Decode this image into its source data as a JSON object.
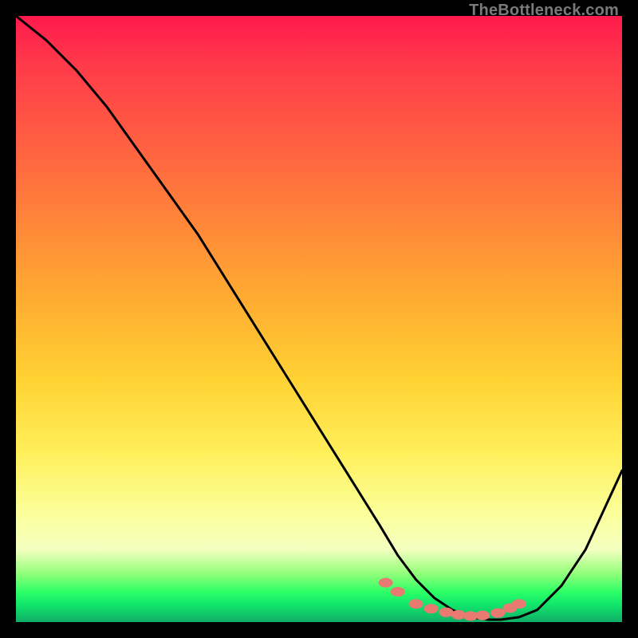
{
  "watermark": "TheBottleneck.com",
  "chart_data": {
    "type": "line",
    "title": "",
    "xlabel": "",
    "ylabel": "",
    "xlim": [
      0,
      100
    ],
    "ylim": [
      0,
      100
    ],
    "series": [
      {
        "name": "bottleneck-curve",
        "x": [
          0,
          5,
          10,
          15,
          20,
          25,
          30,
          35,
          40,
          45,
          50,
          55,
          60,
          63,
          66,
          69,
          72,
          75,
          78,
          80,
          83,
          86,
          90,
          94,
          100
        ],
        "y": [
          100,
          96,
          91,
          85,
          78,
          71,
          64,
          56,
          48,
          40,
          32,
          24,
          16,
          11,
          7,
          4,
          2,
          0.8,
          0.4,
          0.4,
          0.8,
          2,
          6,
          12,
          25
        ]
      }
    ],
    "markers": {
      "name": "optimal-range-markers",
      "color": "#e87a72",
      "xy": [
        [
          61,
          6.5
        ],
        [
          63,
          5.0
        ],
        [
          66,
          3.0
        ],
        [
          68.5,
          2.2
        ],
        [
          71,
          1.6
        ],
        [
          73,
          1.2
        ],
        [
          75,
          1.0
        ],
        [
          77,
          1.1
        ],
        [
          79.5,
          1.5
        ],
        [
          81.5,
          2.3
        ],
        [
          83,
          3.0
        ]
      ]
    },
    "gradient_stops": [
      {
        "pos": 0,
        "color": "#ff1a4d"
      },
      {
        "pos": 8,
        "color": "#ff3a4a"
      },
      {
        "pos": 25,
        "color": "#ff6b3f"
      },
      {
        "pos": 45,
        "color": "#ffa732"
      },
      {
        "pos": 60,
        "color": "#ffd233"
      },
      {
        "pos": 72,
        "color": "#ffef5a"
      },
      {
        "pos": 82,
        "color": "#fbff9a"
      },
      {
        "pos": 88,
        "color": "#f4ffc0"
      },
      {
        "pos": 92,
        "color": "#93ff7a"
      },
      {
        "pos": 95,
        "color": "#2dff66"
      },
      {
        "pos": 97,
        "color": "#12e86c"
      },
      {
        "pos": 100,
        "color": "#0fae66"
      }
    ]
  }
}
